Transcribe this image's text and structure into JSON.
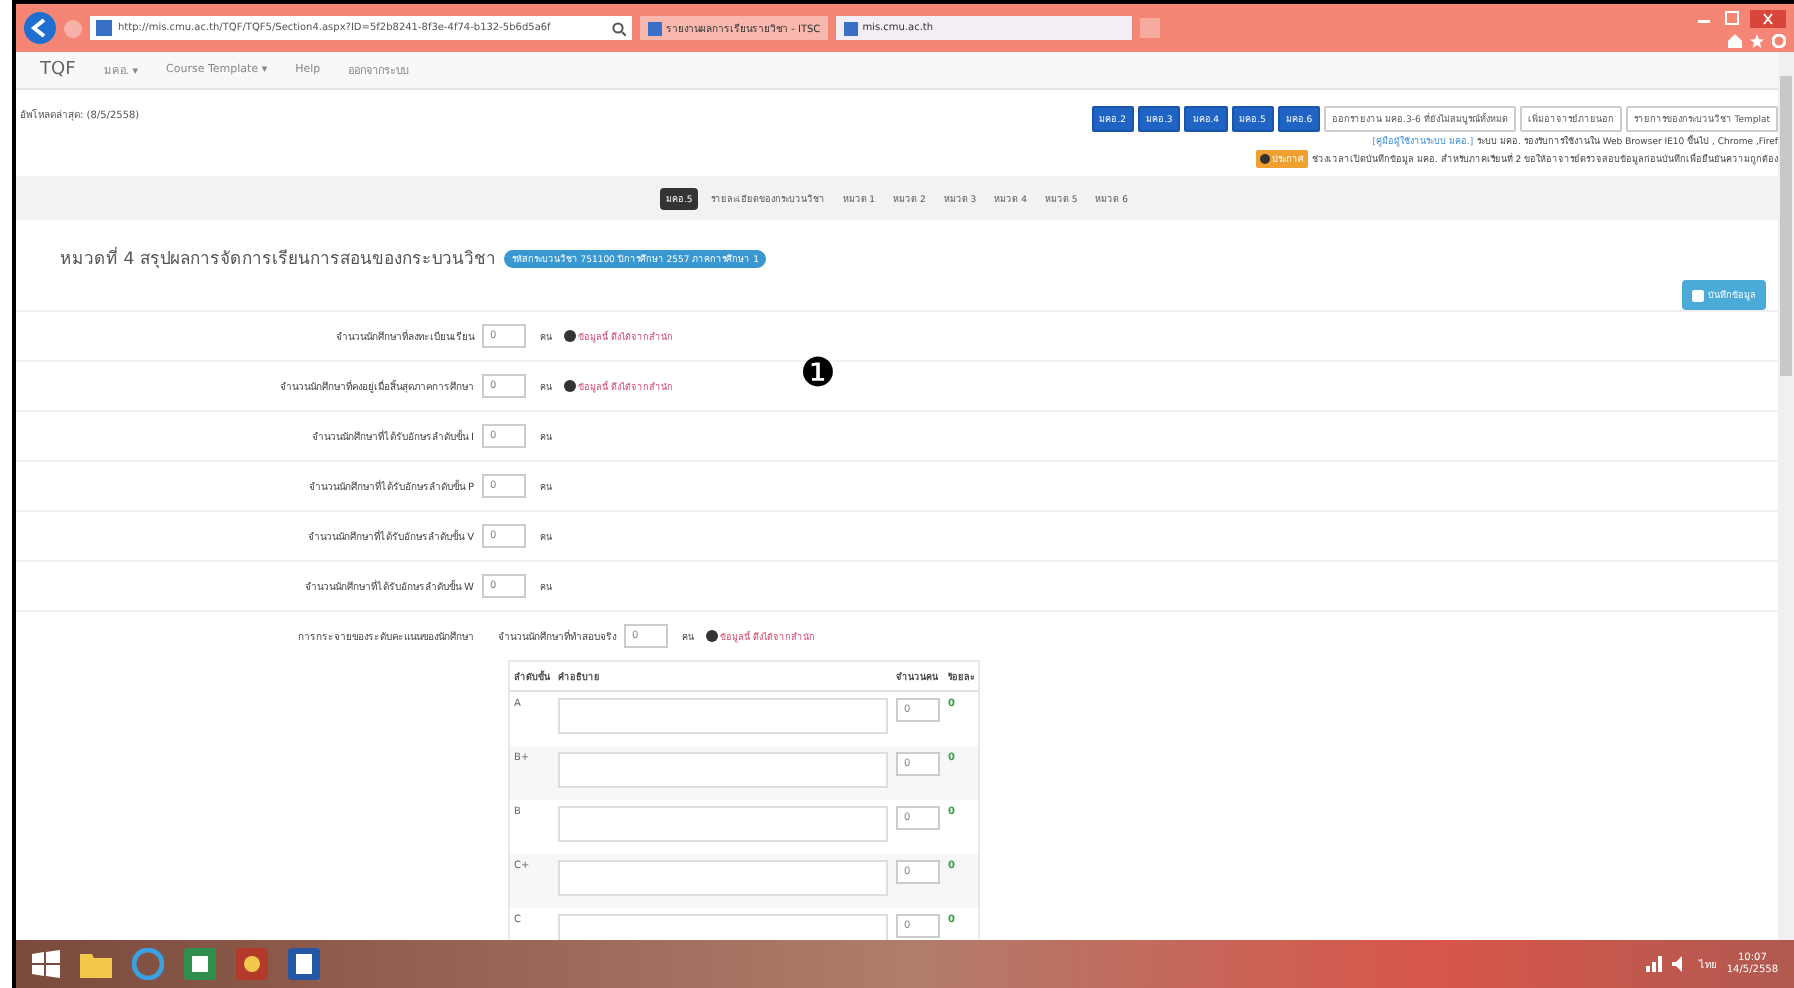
{
  "browser": {
    "address": "http://mis.cmu.ac.th/TQF/TQF5/Section4.aspx?ID=5f2b8241-8f3e-4f74-b132-5b6d5a6f",
    "tabs": [
      {
        "title": "รายงานผลการเรียนรายวิชา - ITSC",
        "selected": false
      },
      {
        "title": "mis.cmu.ac.th",
        "selected": true
      }
    ]
  },
  "navbar": {
    "brand": "TQF",
    "items": [
      "มคอ. ▾",
      "Course Template ▾",
      "Help",
      "ออกจากระบบ"
    ]
  },
  "updated": "อัพโหลดล่าสุด: (8/5/2558)",
  "report_buttons": [
    {
      "label": "มคอ.2",
      "kind": "primary"
    },
    {
      "label": "มคอ.3",
      "kind": "primary"
    },
    {
      "label": "มคอ.4",
      "kind": "primary"
    },
    {
      "label": "มคอ.5",
      "kind": "primary"
    },
    {
      "label": "มคอ.6",
      "kind": "primary"
    },
    {
      "label": "ออกรายงาน มคอ.3-6 ที่ยังไม่สมบูรณ์ทั้งหมด",
      "kind": "default"
    },
    {
      "label": "เพิ่มอาจารย์ภายนอก",
      "kind": "default"
    },
    {
      "label": "รายการของกระบวนวิชา Templat",
      "kind": "default"
    }
  ],
  "manual_link": "[คู่มือผู้ใช้งานระบบ มคอ.]",
  "browser_note": "ระบบ มคอ. รองรับการใช้งานใน Web Browser IE10 ขึ้นไป , Chrome ,Firef",
  "notice": {
    "badge": "ประกาศ",
    "text": "ช่วงเวลาเปิดบันทึกข้อมูล มคอ. สำหรับภาคเรียนที่ 2 ขอให้อาจารย์ตรวจสอบข้อมูลก่อนบันทึกเพื่อยืนยันความถูกต้อง"
  },
  "section_tabs": [
    {
      "label": "มคอ.5",
      "selected": true
    },
    {
      "label": "รายละเอียดของกระบวนวิชา",
      "selected": false
    },
    {
      "label": "หมวด 1",
      "selected": false
    },
    {
      "label": "หมวด 2",
      "selected": false
    },
    {
      "label": "หมวด 3",
      "selected": false
    },
    {
      "label": "หมวด 4",
      "selected": false
    },
    {
      "label": "หมวด 5",
      "selected": false
    },
    {
      "label": "หมวด 6",
      "selected": false
    }
  ],
  "heading": "หมวดที่ 4 สรุปผลการจัดการเรียนการสอนของกระบวนวิชา",
  "course_badge": "รหัสกระบวนวิชา 751100 ปีการศึกษา 2557 ภาคการศึกษา 1",
  "save_button": "บันทึกข้อมูล",
  "annotation": "❶",
  "fields": [
    {
      "label": "จำนวนนักศึกษาที่ลงทะเบียนเรียน",
      "value": "0",
      "unit": "คน",
      "hint": "ข้อมูลนี้ ดึงได้จากสำนัก"
    },
    {
      "label": "จำนวนนักศึกษาที่คงอยู่เมื่อสิ้นสุดภาคการศึกษา",
      "value": "0",
      "unit": "คน",
      "hint": "ข้อมูลนี้ ดึงได้จากสำนัก"
    },
    {
      "label": "จำนวนนักศึกษาที่ได้รับอักษรลำดับขั้น I",
      "value": "0",
      "unit": "คน"
    },
    {
      "label": "จำนวนนักศึกษาที่ได้รับอักษรลำดับขั้น P",
      "value": "0",
      "unit": "คน"
    },
    {
      "label": "จำนวนนักศึกษาที่ได้รับอักษรลำดับขั้น V",
      "value": "0",
      "unit": "คน"
    },
    {
      "label": "จำนวนนักศึกษาที่ได้รับอักษรลำดับขั้น W",
      "value": "0",
      "unit": "คน"
    }
  ],
  "distribution": {
    "label": "การกระจายของระดับคะแนนของนักศึกษา",
    "count_label": "จำนวนนักศึกษาที่ทำสอบจริง",
    "value": "0",
    "unit": "คน",
    "hint": "ข้อมูลนี้ ดึงได้จากสำนัก",
    "columns": [
      "ลำดับขั้น",
      "คำอธิบาย",
      "จำนวนคน",
      "ร้อยละ"
    ],
    "rows": [
      {
        "grade": "A",
        "count": "0",
        "percent": "0"
      },
      {
        "grade": "B+",
        "count": "0",
        "percent": "0"
      },
      {
        "grade": "B",
        "count": "0",
        "percent": "0"
      },
      {
        "grade": "C+",
        "count": "0",
        "percent": "0"
      },
      {
        "grade": "C",
        "count": "0",
        "percent": "0"
      }
    ]
  },
  "taskbar": {
    "language": "ไทย",
    "time": "10:07",
    "date": "14/5/2558"
  }
}
